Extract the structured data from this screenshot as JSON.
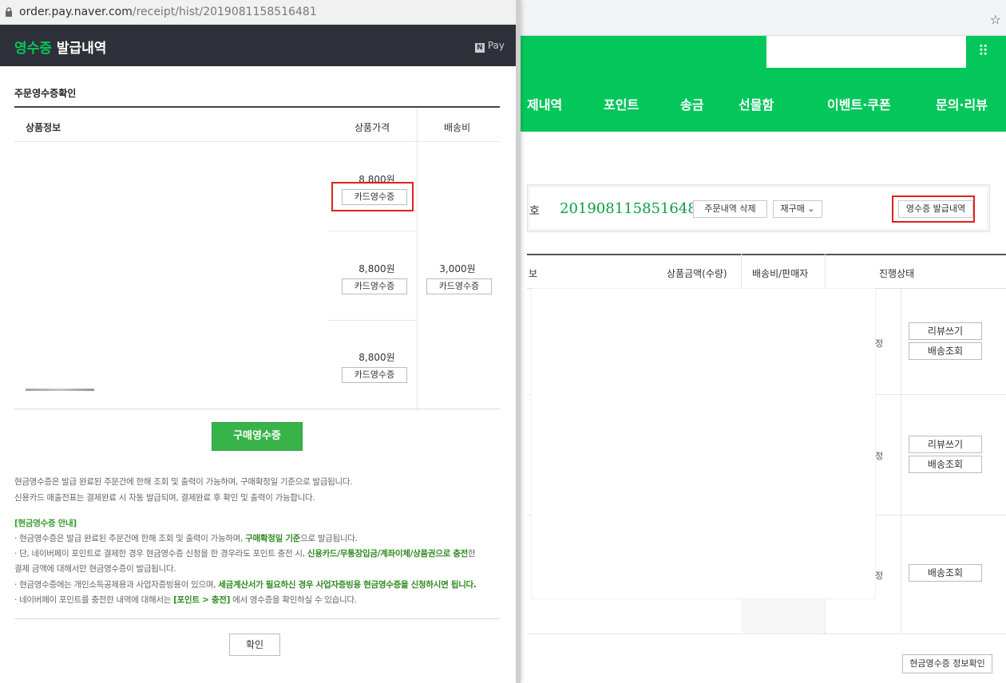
{
  "popup": {
    "url_host": "order.pay.naver.com",
    "url_path": "/receipt/hist/2019081158516481",
    "title_green": "영수증",
    "title_rest": " 발급내역",
    "npay_mark": "N",
    "npay_label": "Pay",
    "section_title": "주문영수증확인",
    "table": {
      "headers": {
        "product": "상품정보",
        "price": "상품가격",
        "shipping": "배송비"
      },
      "rows": [
        {
          "price": "8,800원",
          "button": "카드영수증"
        },
        {
          "price": "8,800원",
          "button": "카드영수증"
        },
        {
          "price": "8,800원",
          "button": "카드영수증"
        }
      ],
      "shipping": {
        "price": "3,000원",
        "button": "카드영수증"
      }
    },
    "buy_receipt_button": "구매영수증",
    "info_lines": [
      "현금영수증은 발급 완료된 주문건에 한해 조회 및 출력이 가능하며, 구매확정일 기준으로 발급됩니다.",
      "신용카드 매출전표는 결제완료 시 자동 발급되며, 결제완료 후 확인 및 출력이 가능합니다."
    ],
    "cash_guide": {
      "heading": "[현금영수증 안내]",
      "bullets": [
        [
          "· 현금영수증은 발급 완료된 주문건에 한해 조회 및 출력이 가능하며, ",
          "구매확정일 기준",
          "으로 발급됩니다."
        ],
        [
          "· 단, 네이버페이 포인트로 결제한 경우 현금영수증 신청을 한 경우라도 포인트 충전 시, ",
          "신용카드/무통장입금/계좌이체/상품권으로 충전",
          "한"
        ],
        [
          "   결제 금액에 대해서만 현금영수증이 발급됩니다.",
          "",
          ""
        ],
        [
          "· 현금영수증에는 개인소득공제용과 사업자증빙용이 있으며, ",
          "세금계산서가 필요하신 경우 사업자증빙용 현금영수증을 신청하시면 됩니다.",
          ""
        ],
        [
          "· 네이버페이 포인트를 충전한 내역에 대해서는 ",
          "[포인트 > 충전]",
          " 에서 영수증을 확인하실 수 있습니다."
        ]
      ]
    },
    "confirm_button": "확인"
  },
  "background": {
    "nav_items": [
      "제내역",
      "포인트",
      "송금",
      "선물함",
      "이벤트·쿠폰",
      "문의·리뷰"
    ],
    "order_prefix": "호",
    "order_number": "2019081158516481",
    "delete_order_button": "주문내역 삭제",
    "reorder_button": "재구매 ⌄",
    "receipt_history_button": "영수증 발급내역",
    "table_headers": {
      "partial": "보",
      "amount": "상품금액(수량)",
      "shipping": "배송비/판매자",
      "status": "진행상태"
    },
    "status_text": "정",
    "review_button": "리뷰쓰기",
    "tracking_button": "배송조회",
    "cash_receipt_info_button": "현금영수증 정보확인"
  },
  "colors": {
    "naver_green": "#03c75a",
    "header_dark": "#2e3139",
    "highlight_red": "#e0201c"
  }
}
